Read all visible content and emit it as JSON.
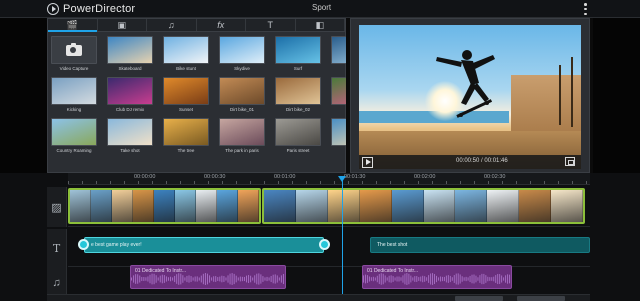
{
  "app": {
    "title": "PowerDirector",
    "project_name": "Sport"
  },
  "library": {
    "tabs": [
      {
        "icon": "video-icon",
        "glyph": "🎬",
        "active": true
      },
      {
        "icon": "image-icon",
        "glyph": "▣",
        "active": false
      },
      {
        "icon": "music-icon",
        "glyph": "♫",
        "active": false
      },
      {
        "icon": "fx-icon",
        "glyph": "fx",
        "active": false
      },
      {
        "icon": "text-icon",
        "glyph": "T",
        "active": false
      },
      {
        "icon": "transition-icon",
        "glyph": "◧",
        "active": false
      }
    ],
    "items": [
      {
        "label": "Video Capture",
        "type": "camera"
      },
      {
        "label": "Skateboard",
        "colors": [
          "#3d86c4",
          "#e6d2b0"
        ]
      },
      {
        "label": "Bike stunt",
        "colors": [
          "#6fb1e2",
          "#f1f4f7"
        ]
      },
      {
        "label": "Skydive",
        "colors": [
          "#5aa7e0",
          "#dfeef8"
        ]
      },
      {
        "label": "Surf",
        "colors": [
          "#1c6fa8",
          "#67c2e6"
        ]
      },
      {
        "label": "My vide",
        "colors": [
          "#2a5e8c",
          "#9fc7e0"
        ]
      },
      {
        "label": "Kicking",
        "colors": [
          "#7aa0c2",
          "#d4dbe0"
        ]
      },
      {
        "label": "Club DJ remix",
        "colors": [
          "#3b2a6e",
          "#c93d8f"
        ]
      },
      {
        "label": "Sunset",
        "colors": [
          "#e08a2b",
          "#7a3d16"
        ]
      },
      {
        "label": "Dirt bike_01",
        "colors": [
          "#c28b55",
          "#6d4a2a"
        ]
      },
      {
        "label": "Dirt bike_02",
        "colors": [
          "#9a6a3c",
          "#e0c497"
        ]
      },
      {
        "label": "Flower",
        "colors": [
          "#4a7a3a",
          "#d65d8c"
        ]
      },
      {
        "label": "Country Roaming",
        "colors": [
          "#8cc2e8",
          "#8aa85b"
        ]
      },
      {
        "label": "Take shot",
        "colors": [
          "#8ab8dc",
          "#f0e0c8"
        ]
      },
      {
        "label": "The tree",
        "colors": [
          "#e8b04a",
          "#7a5a22"
        ]
      },
      {
        "label": "The park in paris",
        "colors": [
          "#c6a6a0",
          "#6b4b5a"
        ]
      },
      {
        "label": "Paris street",
        "colors": [
          "#9c9a94",
          "#4a4844"
        ]
      },
      {
        "label": "Beach",
        "colors": [
          "#4a8fc4",
          "#e8d6b0"
        ]
      }
    ]
  },
  "preview": {
    "time_current": "00:00:50",
    "time_total": "00:01:46",
    "time_separator": "/"
  },
  "timeline": {
    "ruler_labels": [
      "00:00:00",
      "00:00:30",
      "00:01:00",
      "00:01:30",
      "00:02:00",
      "00:02:30"
    ],
    "video_clips": [
      {
        "frames": [
          "#9fc3d8",
          "#6aa0c8",
          "#f2cf9a",
          "#d89548",
          "#3c82c0",
          "#8ac7e6",
          "#e9eef2",
          "#5aa5de",
          "#f0a45a"
        ]
      },
      {
        "frames": [
          "#4a86c2",
          "#b6d6ea",
          "#ffd48a",
          "#e59a4b",
          "#5a9bd2",
          "#c9e3f3",
          "#7cb6e2",
          "#eef2f5",
          "#c88a4a",
          "#f6e7c9"
        ]
      }
    ],
    "title_clips": [
      {
        "text": "e best game play ever!",
        "selected": true
      },
      {
        "text": "The best shot",
        "selected": false
      }
    ],
    "audio_clips": [
      {
        "text": "01 Dedicated To Instr..."
      },
      {
        "text": "01 Dedicated To Instr..."
      }
    ]
  },
  "colors": {
    "accent": "#1fa3e8",
    "video_clip_border": "#8cbf3a",
    "title_clip": "#1a8f99",
    "audio_clip": "#6a2f7d"
  }
}
